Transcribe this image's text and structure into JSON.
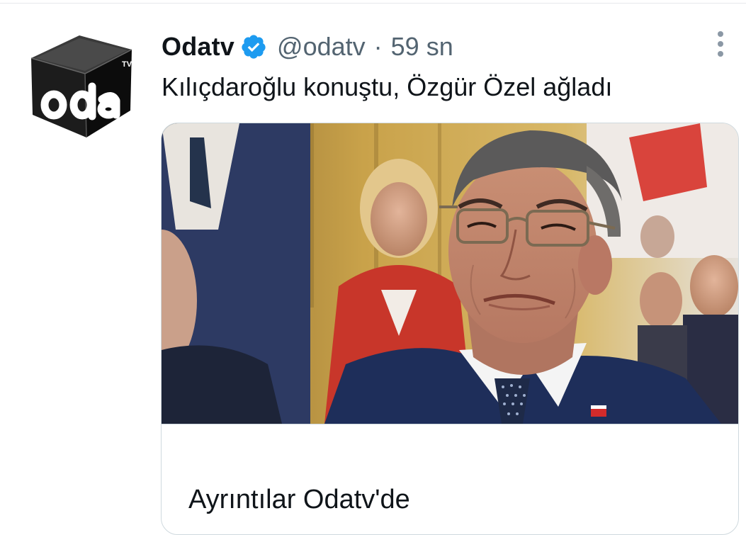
{
  "tweet": {
    "author": {
      "display_name": "Odatv",
      "handle": "@odatv",
      "verified": true,
      "avatar_text": "oda",
      "avatar_superscript": "TV"
    },
    "separator": "·",
    "timestamp": "59 sn",
    "text": "Kılıçdaroğlu konuştu, Özgür Özel ağladı",
    "more_icon": "more-vertical-icon",
    "link_card": {
      "title": "Ayrıntılar Odatv'de",
      "image_description_icon": "photo"
    }
  },
  "colors": {
    "text_primary": "#0f1419",
    "text_secondary": "#536471",
    "verified_blue": "#1d9bf0",
    "card_border": "#cfd9de"
  }
}
